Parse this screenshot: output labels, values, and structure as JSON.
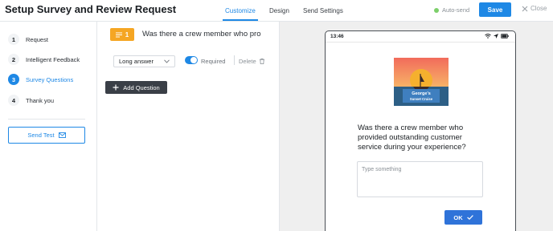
{
  "header": {
    "title": "Setup Survey and Review Request",
    "tabs": [
      {
        "label": "Customize",
        "active": true
      },
      {
        "label": "Design",
        "active": false
      },
      {
        "label": "Send Settings",
        "active": false
      }
    ],
    "autosend_label": "Auto-send",
    "save_label": "Save",
    "close_label": "Close"
  },
  "sidebar": {
    "steps": [
      {
        "number": "1",
        "label": "Request"
      },
      {
        "number": "2",
        "label": "Intelligent Feedback"
      },
      {
        "number": "3",
        "label": "Survey Questions"
      },
      {
        "number": "4",
        "label": "Thank you"
      }
    ],
    "active_step": 3,
    "send_test_label": "Send Test"
  },
  "editor": {
    "question_number": "1",
    "question_text": "Was there a crew member who pro",
    "answer_type": "Long answer",
    "required_label": "Required",
    "required_on": true,
    "delete_label": "Delete",
    "add_question_label": "Add Question"
  },
  "preview": {
    "time": "13:46",
    "logo_text_line1": "George's",
    "logo_text_line2": "Sunset Cruise",
    "question": "Was there a crew member who provided outstanding customer service during your experience?",
    "input_placeholder": "Type something",
    "ok_label": "OK"
  },
  "colors": {
    "accent": "#1e88e5",
    "badge_orange": "#f5a623",
    "autosend_dot": "#7ccf6a",
    "dark_button": "#3a3f47"
  }
}
